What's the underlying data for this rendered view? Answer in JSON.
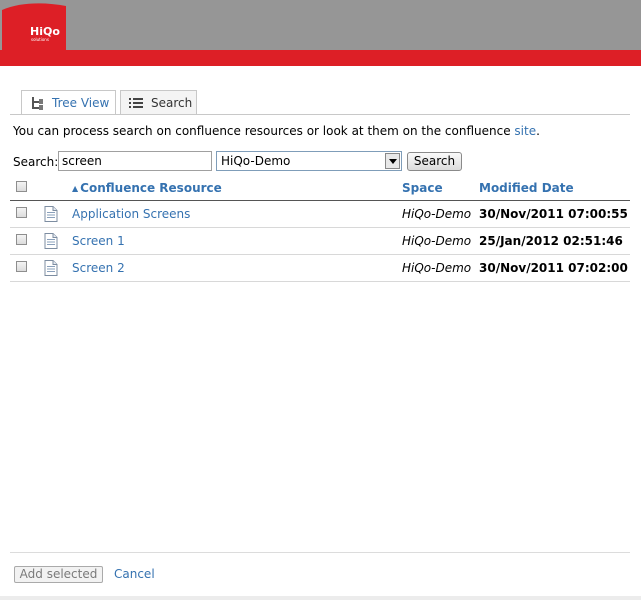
{
  "header": {
    "logo_text": "HiQo",
    "logo_sub": "solutions",
    "brand_color": "#dd1f26"
  },
  "tabs": [
    {
      "label": "Tree View",
      "icon": "tree-icon",
      "active": false
    },
    {
      "label": "Search",
      "icon": "list-icon",
      "active": true
    }
  ],
  "intro": {
    "text": "You can process search on confluence resources or look at them on the confluence ",
    "link": "site",
    "suffix": "."
  },
  "search": {
    "label": "Search:",
    "value": "screen",
    "space_selected": "HiQo-Demo",
    "button": "Search"
  },
  "table": {
    "columns": [
      "Confluence Resource",
      "Space",
      "Modified Date"
    ],
    "rows": [
      {
        "name": "Application Screens",
        "space": "HiQo-Demo",
        "date": "30/Nov/2011 07:00:55"
      },
      {
        "name": "Screen 1",
        "space": "HiQo-Demo",
        "date": "25/Jan/2012 02:51:46"
      },
      {
        "name": "Screen 2",
        "space": "HiQo-Demo",
        "date": "30/Nov/2011 07:02:00"
      }
    ]
  },
  "footer": {
    "add_label": "Add selected",
    "cancel_label": "Cancel"
  }
}
